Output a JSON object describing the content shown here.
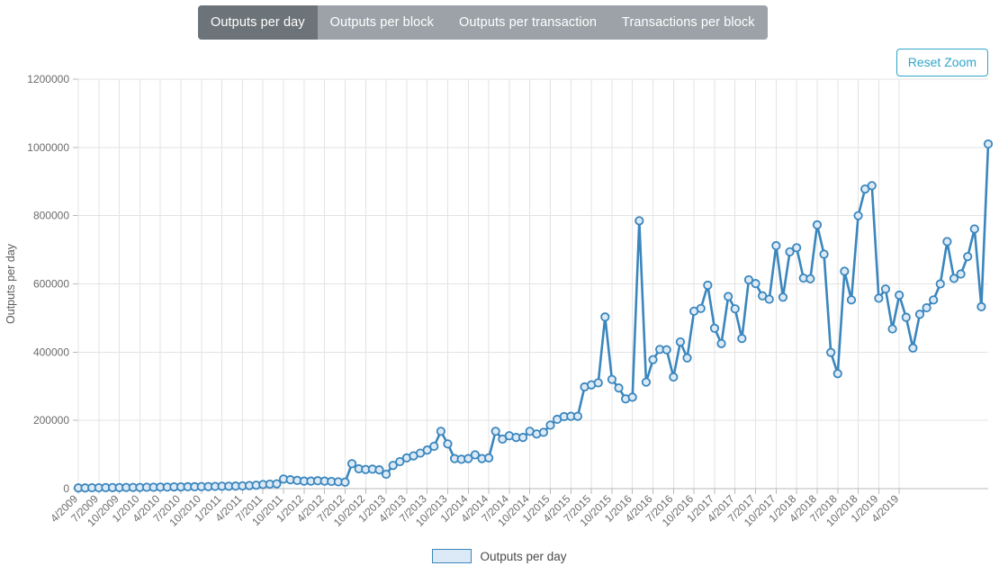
{
  "tabs": [
    {
      "label": "Outputs per day",
      "active": true
    },
    {
      "label": "Outputs per block",
      "active": false
    },
    {
      "label": "Outputs per transaction",
      "active": false
    },
    {
      "label": "Transactions per block",
      "active": false
    }
  ],
  "controls": {
    "reset_zoom_label": "Reset Zoom"
  },
  "legend": {
    "entries": [
      {
        "label": "Outputs per day",
        "color": "#3a86bd",
        "fill": "#dceaf7"
      }
    ]
  },
  "colors": {
    "series_line": "#3a86bd",
    "series_marker_fill": "#dceaf7",
    "accent": "#2fa5c8",
    "tab_active_bg": "#6d7479",
    "tab_inactive_bg": "#9ca2a8",
    "grid": "#e3e3e3",
    "axis": "#b9b9b9"
  },
  "chart_data": {
    "type": "line",
    "title": "",
    "xlabel": "",
    "ylabel": "Outputs per day",
    "ylim": [
      0,
      1200000
    ],
    "ytick_step": 200000,
    "yticks": [
      0,
      200000,
      400000,
      600000,
      800000,
      1000000,
      1200000
    ],
    "ytick_labels": [
      "0",
      "200000",
      "400000",
      "600000",
      "800000",
      "1000000",
      "1200000"
    ],
    "grid": true,
    "legend_position": "bottom",
    "xtick_labels": [
      "4/2009",
      "7/2009",
      "10/2009",
      "1/2010",
      "4/2010",
      "7/2010",
      "10/2010",
      "1/2011",
      "4/2011",
      "7/2011",
      "10/2011",
      "1/2012",
      "4/2012",
      "7/2012",
      "10/2012",
      "1/2013",
      "4/2013",
      "7/2013",
      "10/2013",
      "1/2014",
      "4/2014",
      "7/2014",
      "10/2014",
      "1/2015",
      "4/2015",
      "7/2015",
      "10/2015",
      "1/2016",
      "4/2016",
      "7/2016",
      "10/2016",
      "1/2017",
      "4/2017",
      "7/2017",
      "10/2017",
      "1/2018",
      "4/2018",
      "7/2018",
      "10/2018",
      "1/2019",
      "4/2019"
    ],
    "xtick_interval_months": 3,
    "x_start": "4/2009",
    "x_end": "4/2019",
    "series": [
      {
        "name": "Outputs per day",
        "x": [
          "4/2009",
          "5/2009",
          "6/2009",
          "7/2009",
          "8/2009",
          "9/2009",
          "10/2009",
          "11/2009",
          "12/2009",
          "1/2010",
          "2/2010",
          "3/2010",
          "4/2010",
          "5/2010",
          "6/2010",
          "7/2010",
          "8/2010",
          "9/2010",
          "10/2010",
          "11/2010",
          "12/2010",
          "1/2011",
          "2/2011",
          "3/2011",
          "4/2011",
          "5/2011",
          "6/2011",
          "7/2011",
          "8/2011",
          "9/2011",
          "10/2011",
          "11/2011",
          "12/2011",
          "1/2012",
          "2/2012",
          "3/2012",
          "4/2012",
          "5/2012",
          "6/2012",
          "7/2012",
          "8/2012",
          "9/2012",
          "10/2012",
          "11/2012",
          "12/2012",
          "1/2013",
          "2/2013",
          "3/2013",
          "4/2013",
          "5/2013",
          "6/2013",
          "7/2013",
          "8/2013",
          "9/2013",
          "10/2013",
          "11/2013",
          "12/2013",
          "1/2014",
          "2/2014",
          "3/2014",
          "4/2014",
          "5/2014",
          "6/2014",
          "7/2014",
          "8/2014",
          "9/2014",
          "10/2014",
          "11/2014",
          "12/2014",
          "1/2015",
          "2/2015",
          "3/2015",
          "4/2015",
          "5/2015",
          "6/2015",
          "7/2015",
          "8/2015",
          "9/2015",
          "10/2015",
          "11/2015",
          "12/2015",
          "1/2016",
          "2/2016",
          "3/2016",
          "4/2016",
          "5/2016",
          "6/2016",
          "7/2016",
          "8/2016",
          "9/2016",
          "10/2016",
          "11/2016",
          "12/2016",
          "1/2017",
          "2/2017",
          "3/2017",
          "4/2017",
          "5/2017",
          "6/2017",
          "7/2017",
          "8/2017",
          "9/2017",
          "10/2017",
          "11/2017",
          "12/2017",
          "1/2018",
          "2/2018",
          "3/2018",
          "4/2018",
          "5/2018",
          "6/2018",
          "7/2018",
          "8/2018",
          "9/2018",
          "10/2018",
          "11/2018",
          "12/2018",
          "1/2019",
          "2/2019",
          "3/2019",
          "4/2019"
        ],
        "values": [
          2000,
          2000,
          2500,
          2500,
          3000,
          3000,
          3000,
          3500,
          3500,
          3500,
          4000,
          4000,
          4500,
          4500,
          5000,
          5000,
          5500,
          5500,
          6000,
          6000,
          6500,
          7000,
          7000,
          7500,
          8000,
          9000,
          10000,
          12000,
          13000,
          14000,
          28000,
          26000,
          24000,
          22000,
          22000,
          23000,
          22000,
          21000,
          20000,
          19000,
          73000,
          58000,
          56000,
          57000,
          55000,
          42000,
          68000,
          79000,
          90000,
          96000,
          104000,
          113000,
          124000,
          168000,
          131000,
          88000,
          86000,
          88000,
          99000,
          88000,
          90000,
          168000,
          145000,
          155000,
          150000,
          150000,
          168000,
          160000,
          165000,
          186000,
          203000,
          211000,
          212000,
          212000,
          298000,
          304000,
          310000,
          503000,
          320000,
          295000,
          263000,
          268000,
          785000,
          312000,
          378000,
          408000,
          407000,
          327000,
          430000,
          383000,
          520000,
          528000,
          596000,
          470000,
          425000,
          563000,
          527000,
          440000,
          612000,
          601000,
          565000,
          555000,
          712000,
          561000,
          694000,
          706000,
          617000,
          615000,
          773000,
          687000,
          399000,
          337000,
          637000,
          553000,
          800000,
          878000,
          888000,
          558000,
          585000,
          468000,
          567000,
          502000,
          412000,
          511000,
          530000,
          553000,
          600000,
          724000,
          616000,
          629000,
          680000,
          761000,
          533000,
          1010000
        ]
      }
    ]
  }
}
